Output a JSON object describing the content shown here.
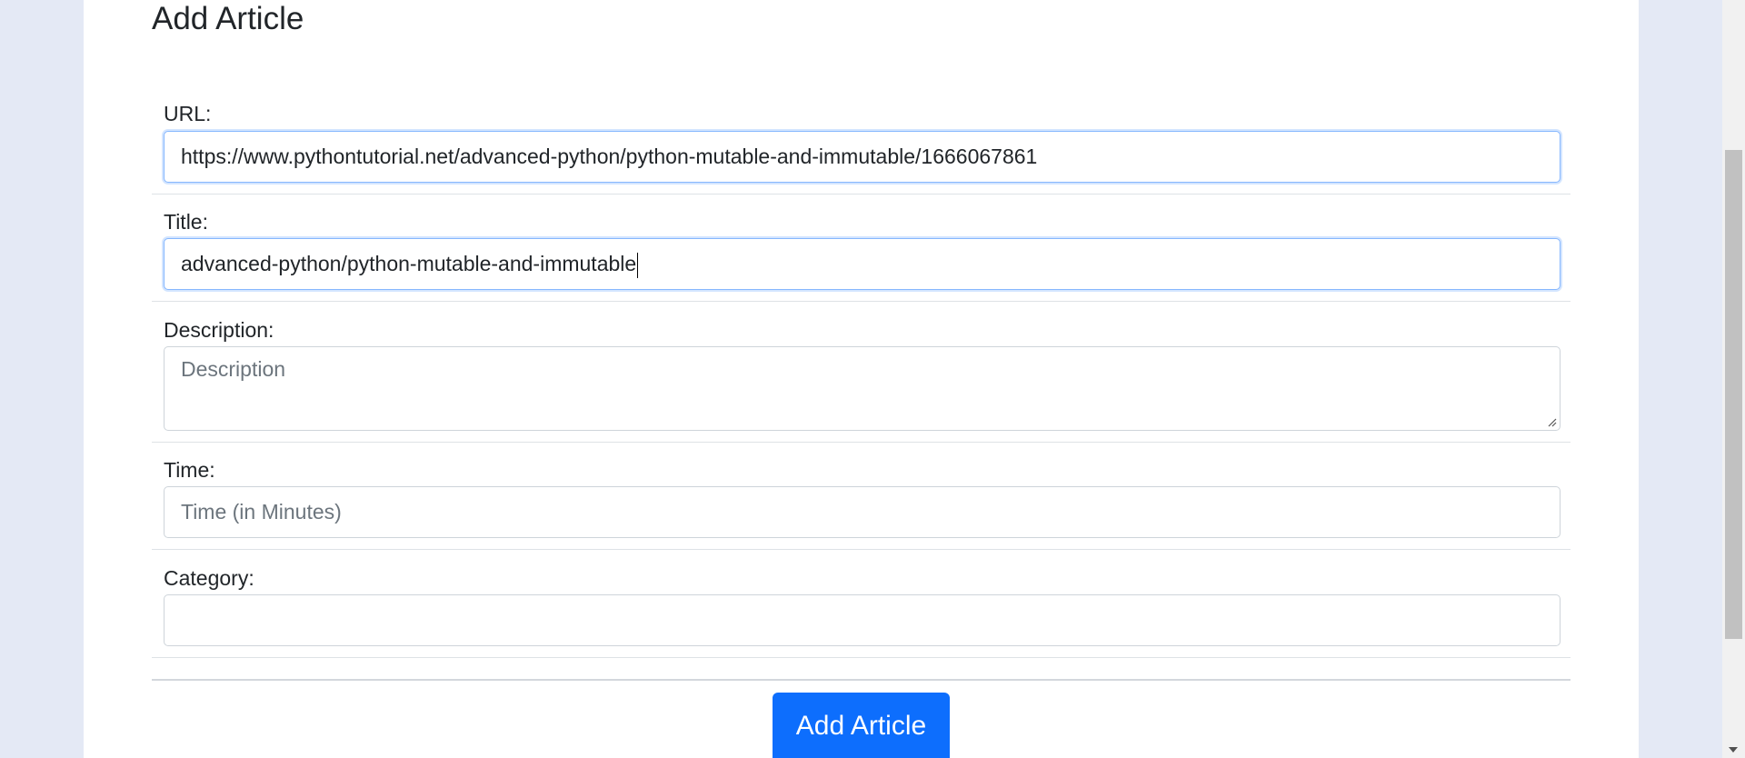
{
  "page": {
    "title": "Add Article"
  },
  "form": {
    "url": {
      "label": "URL:",
      "value": "https://www.pythontutorial.net/advanced-python/python-mutable-and-immutable/1666067861"
    },
    "title": {
      "label": "Title:",
      "value": "advanced-python/python-mutable-and-immutable"
    },
    "description": {
      "label": "Description:",
      "placeholder": "Description",
      "value": ""
    },
    "time": {
      "label": "Time:",
      "placeholder": "Time (in Minutes)",
      "value": ""
    },
    "category": {
      "label": "Category:",
      "value": ""
    },
    "submit_label": "Add Article"
  },
  "colors": {
    "background": "#e4e9f5",
    "card": "#ffffff",
    "primary_button": "#0d6efd",
    "focus_border": "#86b7fe",
    "input_border": "#ced4da"
  },
  "icons": {
    "textarea_resize": "resize-grip-icon",
    "scroll_down": "scroll-down-arrow-icon"
  }
}
